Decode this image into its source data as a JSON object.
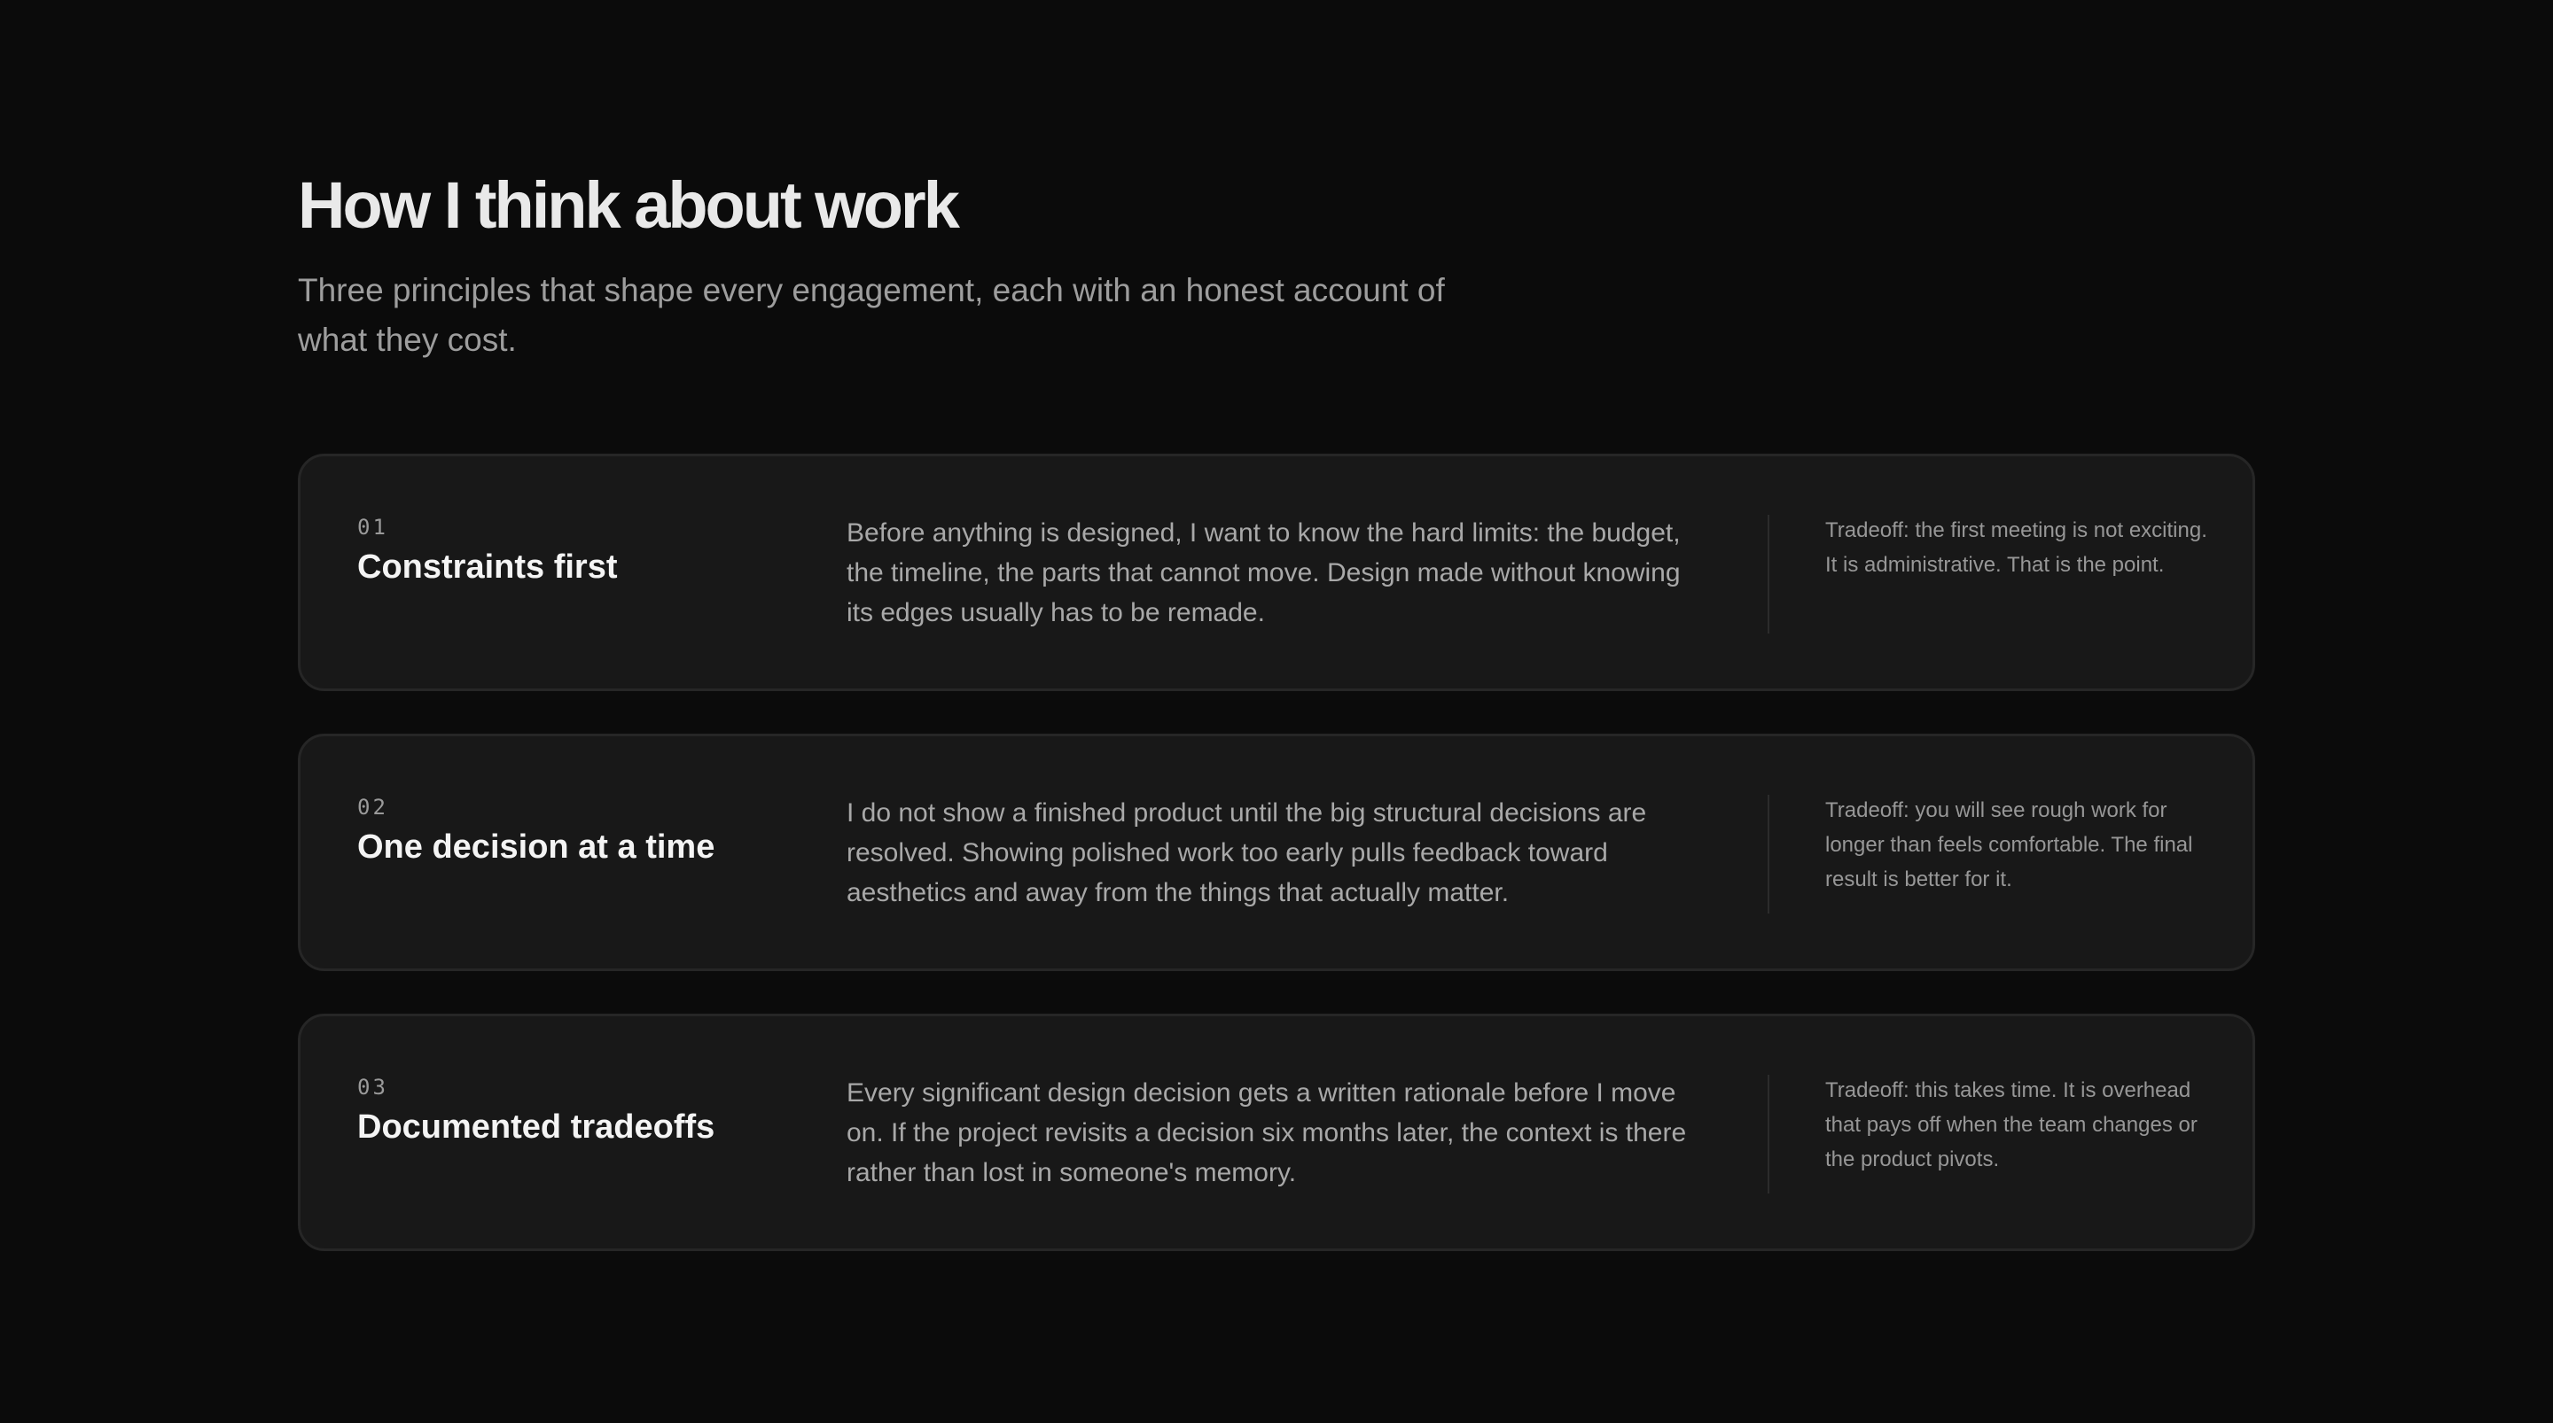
{
  "header": {
    "title": "How I think about work",
    "subtitle": "Three principles that shape every engagement, each with an honest account of what they cost."
  },
  "principles": [
    {
      "number": "01",
      "title": "Constraints first",
      "body": "Before anything is designed, I want to know the hard limits: the budget, the timeline, the parts that cannot move. Design made without knowing its edges usually has to be remade.",
      "tradeoff": "Tradeoff: the first meeting is not exciting. It is administrative. That is the point."
    },
    {
      "number": "02",
      "title": "One decision at a time",
      "body": "I do not show a finished product until the big structural decisions are resolved. Showing polished work too early pulls feedback toward aesthetics and away from the things that actually matter.",
      "tradeoff": "Tradeoff: you will see rough work for longer than feels comfortable. The final result is better for it."
    },
    {
      "number": "03",
      "title": "Documented tradeoffs",
      "body": "Every significant design decision gets a written rationale before I move on. If the project revisits a decision six months later, the context is there rather than lost in someone's memory.",
      "tradeoff": "Tradeoff: this takes time. It is overhead that pays off when the team changes or the product pivots."
    }
  ],
  "colors": {
    "background": "#0b0b0b",
    "card": "#181818",
    "card_border": "#262626",
    "heading": "#e9e9e9",
    "muted": "#9d9d9d"
  }
}
